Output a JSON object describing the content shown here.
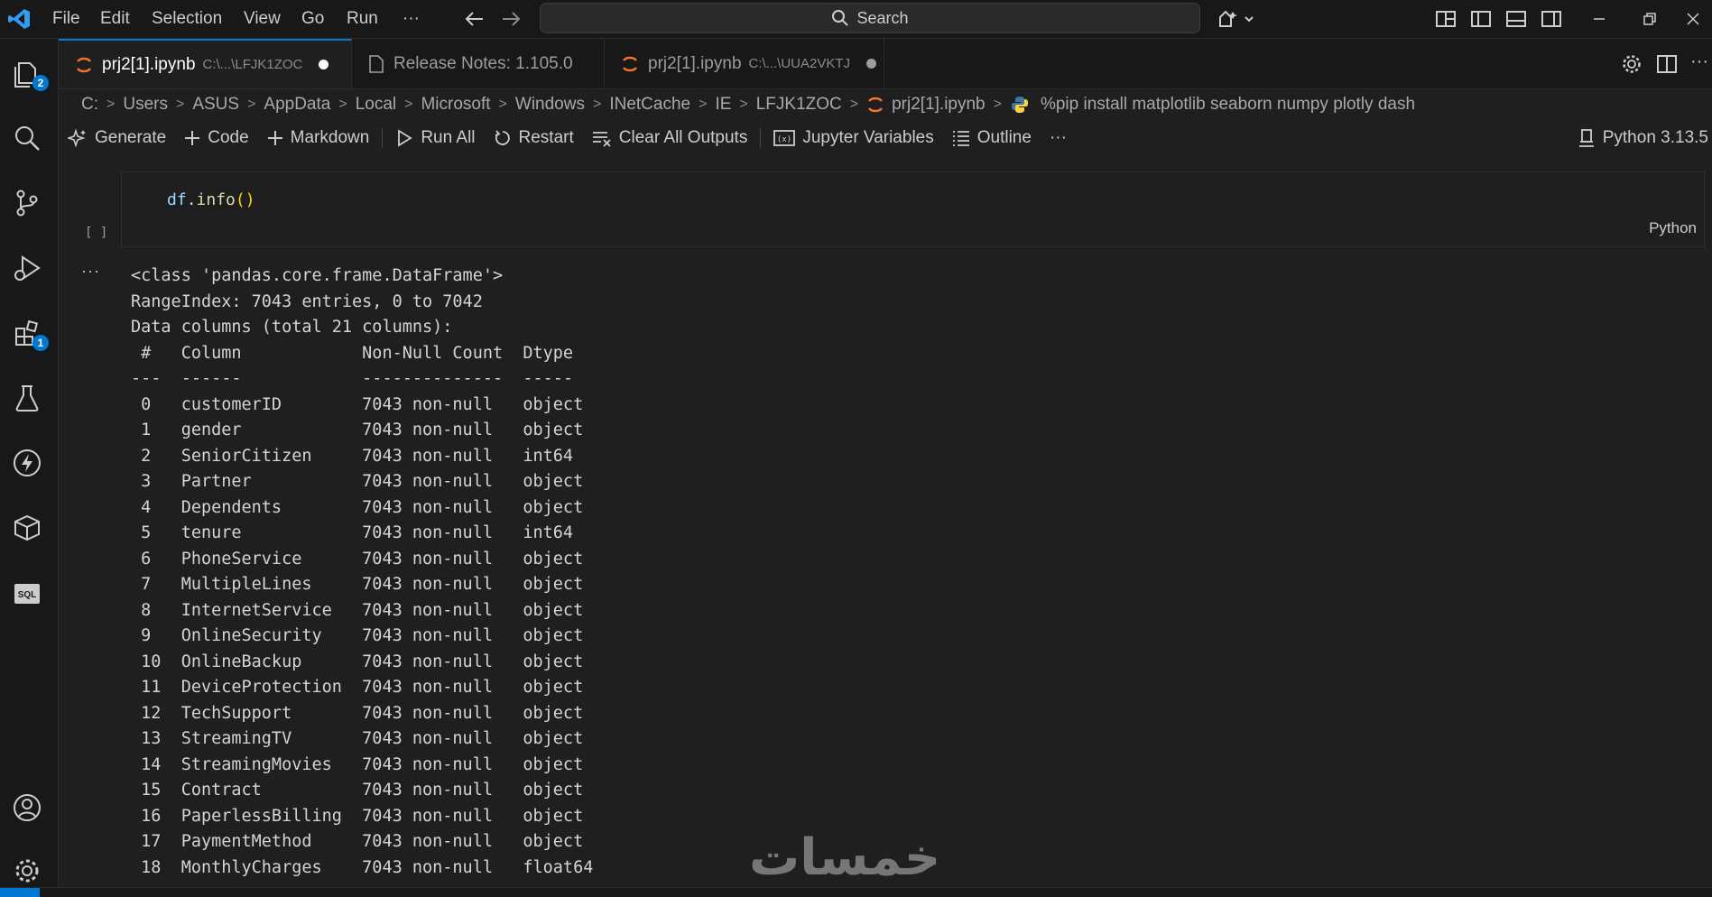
{
  "menu": [
    "File",
    "Edit",
    "Selection",
    "View",
    "Go",
    "Run",
    "···"
  ],
  "search": {
    "label": "Search"
  },
  "activity": {
    "explorer_badge": "2",
    "extensions_badge": "1",
    "sql_label": "SQL"
  },
  "tabs": [
    {
      "name": "prj2[1].ipynb",
      "path": "C:\\...\\LFJK1ZOC"
    },
    {
      "name": "Release Notes: 1.105.0",
      "path": ""
    },
    {
      "name": "prj2[1].ipynb",
      "path": "C:\\...\\UUA2VKTJ"
    }
  ],
  "breadcrumb": [
    "C:",
    "Users",
    "ASUS",
    "AppData",
    "Local",
    "Microsoft",
    "Windows",
    "INetCache",
    "IE",
    "LFJK1ZOC",
    "prj2[1].ipynb",
    "%pip install matplotlib seaborn numpy plotly dash"
  ],
  "toolbar": {
    "generate": "Generate",
    "code": "Code",
    "markdown": "Markdown",
    "run_all": "Run All",
    "restart": "Restart",
    "clear_outputs": "Clear All Outputs",
    "jupyter_variables": "Jupyter Variables",
    "outline": "Outline",
    "more": "···",
    "kernel": "Python 3.13.5"
  },
  "cell": {
    "code": "df.info()",
    "exec_count": "[ ]",
    "language": "Python",
    "output_more": "···",
    "output": "<class 'pandas.core.frame.DataFrame'>\nRangeIndex: 7043 entries, 0 to 7042\nData columns (total 21 columns):\n #   Column            Non-Null Count  Dtype  \n---  ------            --------------  -----  \n 0   customerID        7043 non-null   object \n 1   gender            7043 non-null   object \n 2   SeniorCitizen     7043 non-null   int64  \n 3   Partner           7043 non-null   object \n 4   Dependents        7043 non-null   object \n 5   tenure            7043 non-null   int64  \n 6   PhoneService      7043 non-null   object \n 7   MultipleLines     7043 non-null   object \n 8   InternetService   7043 non-null   object \n 9   OnlineSecurity    7043 non-null   object \n 10  OnlineBackup      7043 non-null   object \n 11  DeviceProtection  7043 non-null   object \n 12  TechSupport       7043 non-null   object \n 13  StreamingTV       7043 non-null   object \n 14  StreamingMovies   7043 non-null   object \n 15  Contract          7043 non-null   object \n 16  PaperlessBilling  7043 non-null   object \n 17  PaymentMethod     7043 non-null   object \n 18  MonthlyCharges    7043 non-null   float64"
  },
  "watermark": "خمسات",
  "colors": {
    "accent": "#0078d4",
    "background": "#1f1f1f",
    "function": "#dcdcaa",
    "variable": "#9cdcfe"
  }
}
